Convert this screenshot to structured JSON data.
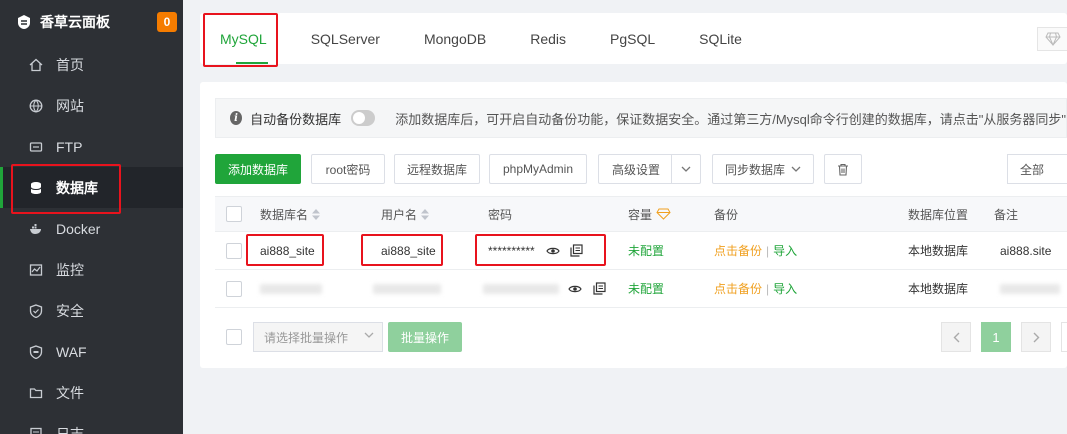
{
  "sidebar": {
    "brand": "香草云面板",
    "badge": "0",
    "items": [
      {
        "label": "首页",
        "icon": "home-icon"
      },
      {
        "label": "网站",
        "icon": "globe-icon"
      },
      {
        "label": "FTP",
        "icon": "ftp-icon"
      },
      {
        "label": "数据库",
        "icon": "database-icon",
        "active": true
      },
      {
        "label": "Docker",
        "icon": "docker-icon"
      },
      {
        "label": "监控",
        "icon": "monitor-icon"
      },
      {
        "label": "安全",
        "icon": "shield-icon"
      },
      {
        "label": "WAF",
        "icon": "waf-icon"
      },
      {
        "label": "文件",
        "icon": "folder-icon"
      },
      {
        "label": "日志",
        "icon": "log-icon"
      }
    ]
  },
  "tabs": [
    "MySQL",
    "SQLServer",
    "MongoDB",
    "Redis",
    "PgSQL",
    "SQLite"
  ],
  "notice": {
    "toggle_label": "自动备份数据库",
    "text": "添加数据库后，可开启自动备份功能，保证数据安全。通过第三方/Mysql命令行创建的数据库，请点击\"从服务器同步\""
  },
  "toolbar": {
    "add": "添加数据库",
    "root_pwd": "root密码",
    "remote": "远程数据库",
    "phpmyadmin": "phpMyAdmin",
    "advanced": "高级设置",
    "sync": "同步数据库",
    "filter": "全部"
  },
  "table": {
    "headers": {
      "name": "数据库名",
      "user": "用户名",
      "password": "密码",
      "capacity": "容量",
      "backup": "备份",
      "location": "数据库位置",
      "note": "备注"
    },
    "rows": [
      {
        "name": "ai888_site",
        "user": "ai888_site",
        "password": "**********",
        "capacity": "未配置",
        "backup_link": "点击备份",
        "backup_sep": "|",
        "import_link": "导入",
        "location": "本地数据库",
        "note": "ai888.site"
      },
      {
        "name": "",
        "user": "",
        "password": "",
        "capacity": "未配置",
        "backup_link": "点击备份",
        "backup_sep": "|",
        "import_link": "导入",
        "location": "本地数据库",
        "note": ""
      }
    ]
  },
  "footer": {
    "batch_placeholder": "请选择批量操作",
    "batch_button": "批量操作",
    "page_current": "1"
  },
  "colors": {
    "accent": "#20a53a",
    "highlight": "#e8131d",
    "sidebar_bg": "#2d3035"
  }
}
